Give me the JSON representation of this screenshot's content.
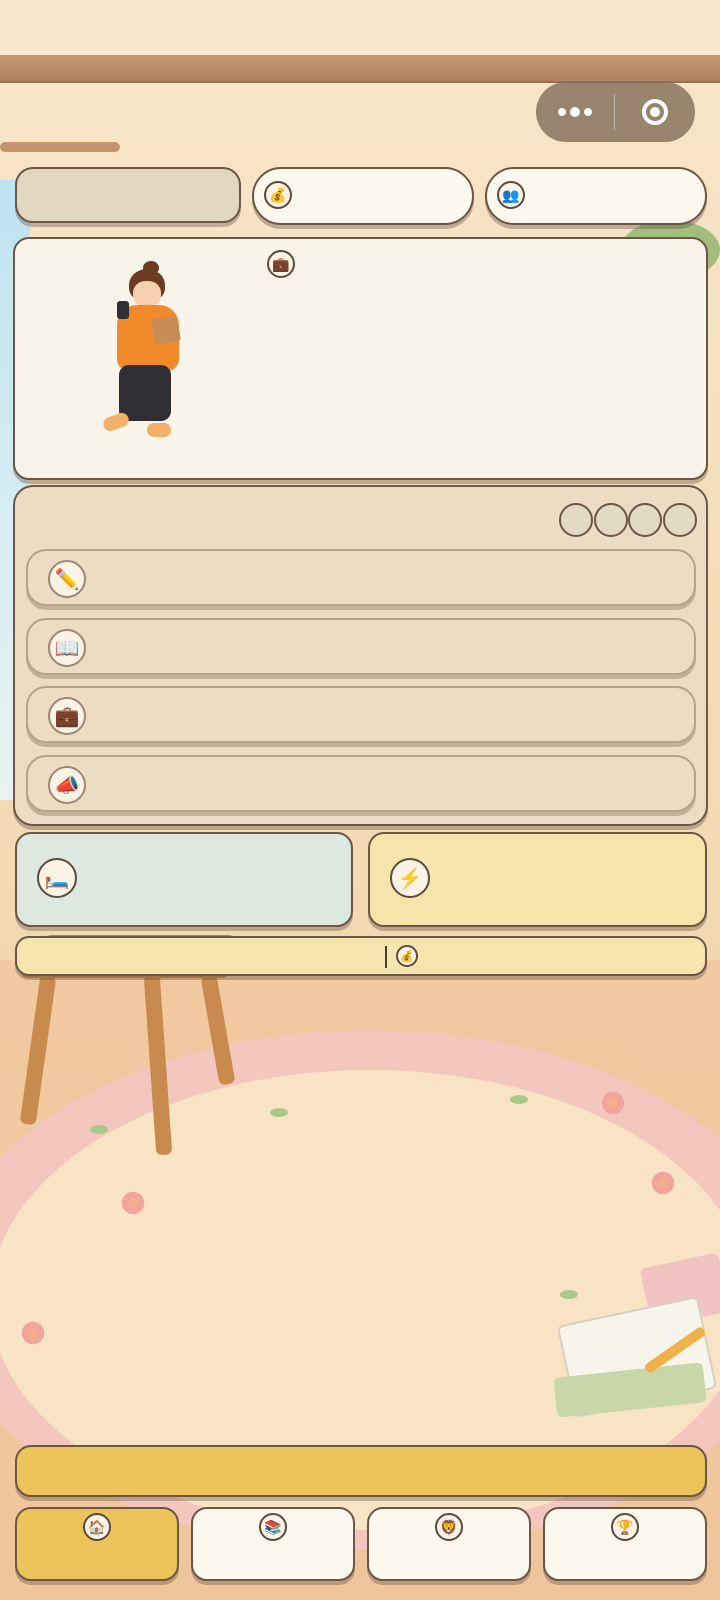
{
  "capsule": {
    "more_icon": "more-dots-icon",
    "close_icon": "target-close-icon"
  },
  "header": {
    "name_pill": "",
    "gold": {
      "icon": "money-bag-icon",
      "value": ""
    },
    "friends": {
      "icon": "people-icon",
      "value": ""
    }
  },
  "character_card": {
    "job_icon": "briefcase-icon",
    "avatar": "girl-orange-hoodie"
  },
  "actions_panel": {
    "slots": [
      "",
      "",
      "",
      ""
    ],
    "items": [
      {
        "icon": "pencil-icon",
        "label": ""
      },
      {
        "icon": "open-book-icon",
        "label": ""
      },
      {
        "icon": "briefcase-icon",
        "label": ""
      },
      {
        "icon": "megaphone-icon",
        "label": ""
      }
    ]
  },
  "status": {
    "sleep": {
      "icon": "bed-icon",
      "label": ""
    },
    "energy": {
      "icon": "lightning-icon",
      "label": ""
    }
  },
  "progress": {
    "icon": "coin-icon",
    "label": ""
  },
  "main_button": {
    "label": ""
  },
  "nav": [
    {
      "icon": "house-icon",
      "label": "",
      "active": true
    },
    {
      "icon": "books-icon",
      "label": "",
      "active": false
    },
    {
      "icon": "lion-icon",
      "label": "",
      "active": false
    },
    {
      "icon": "trophy-icon",
      "label": "",
      "active": false
    }
  ],
  "colors": {
    "accent": "#edc45a",
    "panel": "#ecdcc4",
    "card": "#f9f4ea",
    "border": "#6b5648"
  }
}
